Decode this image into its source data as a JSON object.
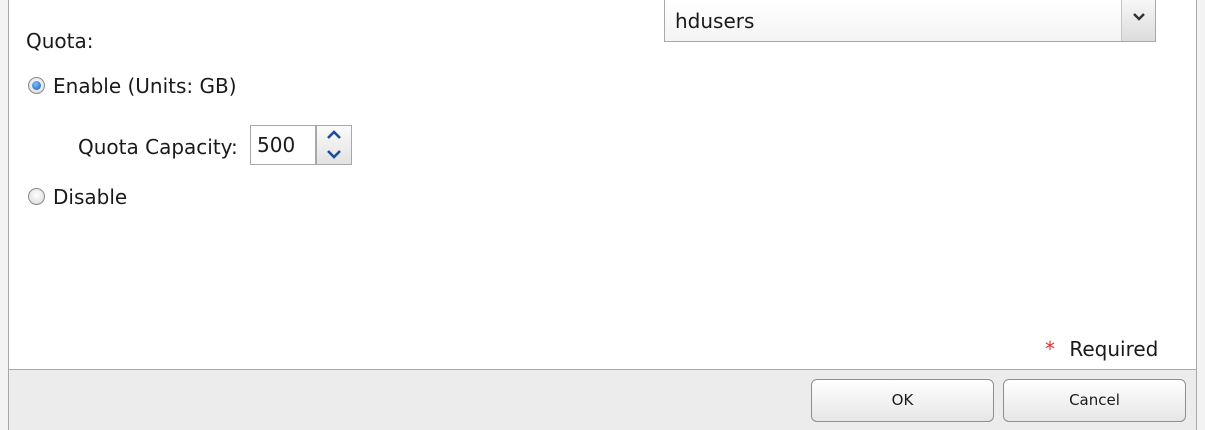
{
  "group": {
    "selected_value": "hdusers"
  },
  "quota": {
    "label": "Quota:",
    "enable_label": "Enable (Units: GB)",
    "enable_checked": true,
    "capacity_label": "Quota Capacity:",
    "capacity_value": "500",
    "disable_label": "Disable",
    "disable_checked": false
  },
  "required": {
    "star": "*",
    "label": "Required"
  },
  "footer": {
    "ok_label": "OK",
    "cancel_label": "Cancel"
  },
  "icons": {
    "dropdown": "chevron-down-icon",
    "spin_up": "chevron-up-icon",
    "spin_down": "chevron-down-icon"
  }
}
